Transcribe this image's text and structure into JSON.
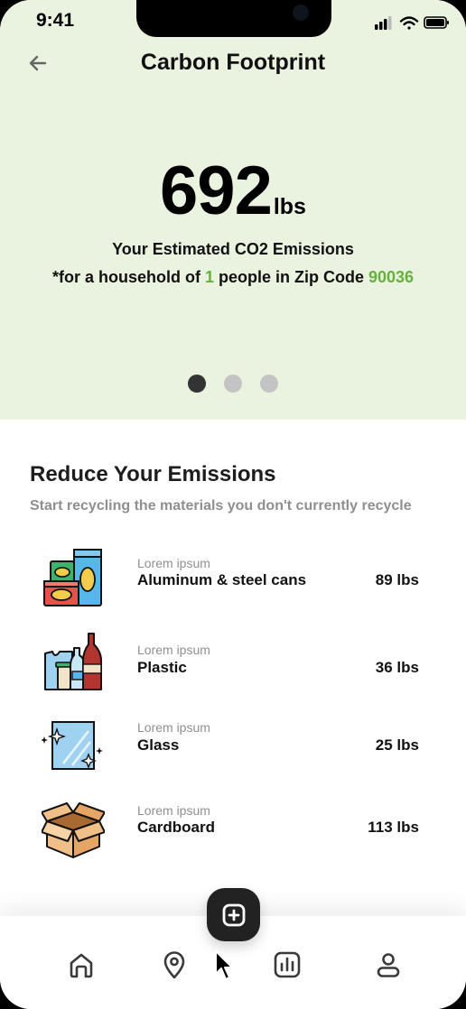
{
  "status_bar": {
    "time": "9:41"
  },
  "header": {
    "title": "Carbon Footprint",
    "back_icon": "arrow-left-icon"
  },
  "summary": {
    "value": "692",
    "unit": "lbs",
    "label": "Your Estimated CO2 Emissions",
    "prefix": "*for a household of ",
    "household_size": "1",
    "middle": " people in Zip Code ",
    "zip_code": "90036",
    "highlight_color": "#66b13b"
  },
  "pager": {
    "count": 3,
    "active_index": 0
  },
  "reduce": {
    "title": "Reduce Your Emissions",
    "subtitle": "Start recycling the materials you don't currently recycle",
    "items": [
      {
        "kicker": "Lorem ipsum",
        "name": "Aluminum & steel cans",
        "value": "89 lbs",
        "icon": "cans-icon"
      },
      {
        "kicker": "Lorem ipsum",
        "name": "Plastic",
        "value": "36 lbs",
        "icon": "plastic-icon"
      },
      {
        "kicker": "Lorem ipsum",
        "name": "Glass",
        "value": "25 lbs",
        "icon": "glass-icon"
      },
      {
        "kicker": "Lorem ipsum",
        "name": "Cardboard",
        "value": "113 lbs",
        "icon": "cardboard-box-icon"
      }
    ]
  },
  "tab_bar": {
    "tabs": [
      "home-icon",
      "map-pin-icon",
      "chart-icon",
      "profile-icon"
    ],
    "fab_icon": "plus-icon"
  },
  "colors": {
    "hero_background": "#eaf3e0",
    "accent_green": "#66b13b",
    "fab": "#222222"
  }
}
